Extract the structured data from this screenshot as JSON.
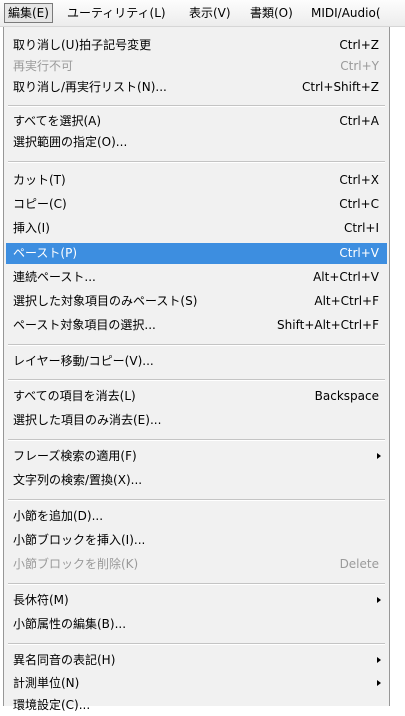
{
  "menubar": {
    "items": [
      {
        "label": "編集(E)"
      },
      {
        "label": "ユーティリティ(L)"
      },
      {
        "label": "表示(V)"
      },
      {
        "label": "書類(O)"
      },
      {
        "label": "MIDI/Audio("
      }
    ]
  },
  "menu": {
    "items": [
      {
        "label": "取り消し(U)拍子記号変更",
        "shortcut": "Ctrl+Z"
      },
      {
        "label": "再実行不可",
        "shortcut": "Ctrl+Y",
        "disabled": true
      },
      {
        "label": "取り消し/再実行リスト(N)...",
        "shortcut": "Ctrl+Shift+Z"
      },
      {
        "label": "すべてを選択(A)",
        "shortcut": "Ctrl+A"
      },
      {
        "label": "選択範囲の指定(O)...",
        "shortcut": ""
      },
      {
        "label": "カット(T)",
        "shortcut": "Ctrl+X"
      },
      {
        "label": "コピー(C)",
        "shortcut": "Ctrl+C"
      },
      {
        "label": "挿入(I)",
        "shortcut": "Ctrl+I"
      },
      {
        "label": "ペースト(P)",
        "shortcut": "Ctrl+V",
        "highlighted": true
      },
      {
        "label": "連続ペースト...",
        "shortcut": "Alt+Ctrl+V"
      },
      {
        "label": "選択した対象項目のみペースト(S)",
        "shortcut": "Alt+Ctrl+F"
      },
      {
        "label": "ペースト対象項目の選択...",
        "shortcut": "Shift+Alt+Ctrl+F"
      },
      {
        "label": "レイヤー移動/コピー(V)...",
        "shortcut": ""
      },
      {
        "label": "すべての項目を消去(L)",
        "shortcut": "Backspace"
      },
      {
        "label": "選択した項目のみ消去(E)...",
        "shortcut": ""
      },
      {
        "label": "フレーズ検索の適用(F)",
        "shortcut": "",
        "submenu": true
      },
      {
        "label": "文字列の検索/置換(X)...",
        "shortcut": ""
      },
      {
        "label": "小節を追加(D)...",
        "shortcut": ""
      },
      {
        "label": "小節ブロックを挿入(I)...",
        "shortcut": ""
      },
      {
        "label": "小節ブロックを削除(K)",
        "shortcut": "Delete",
        "disabled": true
      },
      {
        "label": "長休符(M)",
        "shortcut": "",
        "submenu": true
      },
      {
        "label": "小節属性の編集(B)...",
        "shortcut": ""
      },
      {
        "label": "異名同音の表記(H)",
        "shortcut": "",
        "submenu": true
      },
      {
        "label": "計測単位(N)",
        "shortcut": "",
        "submenu": true
      },
      {
        "label": "環境設定(C)...",
        "shortcut": ""
      }
    ]
  }
}
